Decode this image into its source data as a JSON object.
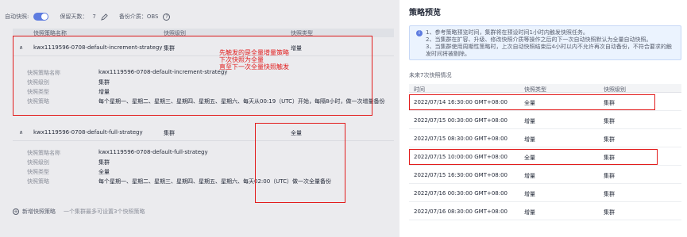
{
  "settings": {
    "auto_snapshot_label": "自动快照:",
    "retention_label": "保留天数：",
    "retention_value": "7",
    "medium_label": "备份介质：OBS"
  },
  "table": {
    "col_name": "快照策略名称",
    "col_level": "快照级别",
    "col_type": "快照类型"
  },
  "strategies": [
    {
      "name": "kwx1119596-0708-default-increment-strategy",
      "level": "集群",
      "type": "增量",
      "details": [
        {
          "k": "快照策略名称",
          "v": "kwx1119596-0708-default-increment-strategy"
        },
        {
          "k": "快照级别",
          "v": "集群"
        },
        {
          "k": "快照类型",
          "v": "增量"
        },
        {
          "k": "快照策略",
          "v": "每个星期一、星期二、星期三、星期四、星期五、星期六、每天从00:19（UTC）开始，每隔8小时，做一次增量备份"
        }
      ]
    },
    {
      "name": "kwx1119596-0708-default-full-strategy",
      "level": "集群",
      "type": "全量",
      "details": [
        {
          "k": "快照策略名称",
          "v": "kwx1119596-0708-default-full-strategy"
        },
        {
          "k": "快照级别",
          "v": "集群"
        },
        {
          "k": "快照类型",
          "v": "全量"
        },
        {
          "k": "快照策略",
          "v": "每个星期一、星期二、星期三、星期四、星期五、星期六、每天02:00（UTC）做一次全量备份"
        }
      ]
    }
  ],
  "annotation": [
    "先触发的是全量增量策略",
    "下次快照为全量",
    "直至下一次全量快照触发"
  ],
  "add_strategy": {
    "label": "新增快照策略",
    "hint": "一个集群最多可设置3个快照策略"
  },
  "panel": {
    "title": "策略预览",
    "info": [
      "1、参考策略预览时间，集群将在预设时间1小时内触发快照任务。",
      "2、当集群在扩容、升级、修改快照介质等操作之后的下一次自动快照默认为全量自动快照。",
      "3、当集群使用周期性策略时，上次自动快照结束后4小时以内不允许再次自动备份，不符合要求的触发时间将被剔除。"
    ],
    "subtitle": "未来7次快照情况",
    "headers": [
      "时间",
      "快照类型",
      "快照级别"
    ],
    "rows": [
      {
        "time": "2022/07/14 16:30:00 GMT+08:00",
        "type": "全量",
        "level": "集群"
      },
      {
        "time": "2022/07/15 00:30:00 GMT+08:00",
        "type": "增量",
        "level": "集群"
      },
      {
        "time": "2022/07/15 08:30:00 GMT+08:00",
        "type": "增量",
        "level": "集群"
      },
      {
        "time": "2022/07/15 10:00:00 GMT+08:00",
        "type": "全量",
        "level": "集群"
      },
      {
        "time": "2022/07/15 16:30:00 GMT+08:00",
        "type": "增量",
        "level": "集群"
      },
      {
        "time": "2022/07/16 00:30:00 GMT+08:00",
        "type": "增量",
        "level": "集群"
      },
      {
        "time": "2022/07/16 08:30:00 GMT+08:00",
        "type": "增量",
        "level": "集群"
      }
    ]
  },
  "colors": {
    "accent": "#5e7ce0",
    "highlight": "#e21d1d"
  }
}
